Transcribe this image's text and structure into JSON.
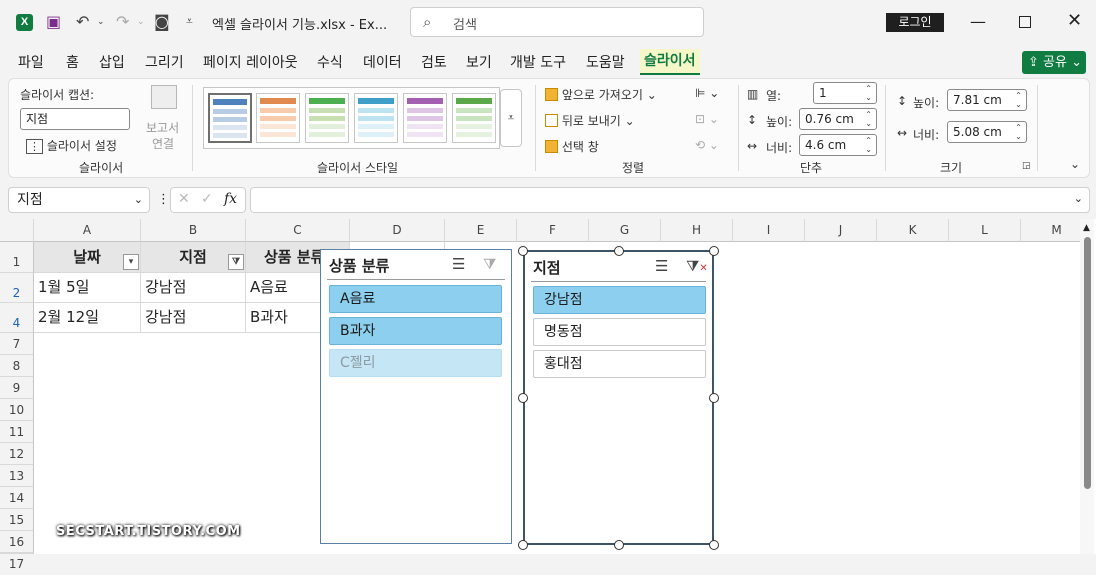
{
  "titlebar": {
    "doc_title": "엑셀 슬라이서 기능.xlsx  -  Ex...",
    "search_placeholder": "검색",
    "login_label": "로그인"
  },
  "tabs": [
    "파일",
    "홈",
    "삽입",
    "그리기",
    "페이지 레이아웃",
    "수식",
    "데이터",
    "검토",
    "보기",
    "개발 도구",
    "도움말",
    "슬라이서"
  ],
  "active_tab": "슬라이서",
  "share_label": "공유",
  "ribbon": {
    "caption_label": "슬라이서 캡션:",
    "caption_value": "지점",
    "settings_label": "슬라이서 설정",
    "report_line1": "보고서",
    "report_line2": "연결",
    "group_slicer": "슬라이서",
    "group_styles": "슬라이서 스타일",
    "bring_forward": "앞으로 가져오기",
    "send_backward": "뒤로 보내기",
    "selection_pane": "선택 창",
    "group_arrange": "정렬",
    "columns_label": "열:",
    "columns_value": "1",
    "btn_height_label": "높이:",
    "btn_height_value": "0.76 cm",
    "btn_width_label": "너비:",
    "btn_width_value": "4.6 cm",
    "group_buttons": "단추",
    "size_height_label": "높이:",
    "size_height_value": "7.81 cm",
    "size_width_label": "너비:",
    "size_width_value": "5.08 cm",
    "group_size": "크기"
  },
  "style_colors": [
    "#4f81bd",
    "#e08a50",
    "#4caf50",
    "#3ea0c8",
    "#a35fb0",
    "#5aa84a"
  ],
  "formula": {
    "namebox": "지점",
    "fx": "fx"
  },
  "columns": [
    "A",
    "B",
    "C",
    "D",
    "E",
    "F",
    "G",
    "H",
    "I",
    "J",
    "K",
    "L",
    "M"
  ],
  "rows": [
    "1",
    "2",
    "4",
    "7",
    "8",
    "9",
    "10",
    "11",
    "12",
    "13",
    "14",
    "15",
    "16",
    "17"
  ],
  "table": {
    "headers": [
      "날짜",
      "지점",
      "상품 분류"
    ],
    "data": [
      [
        "1월 5일",
        "강남점",
        "A음료"
      ],
      [
        "2월 12일",
        "강남점",
        "B과자"
      ]
    ]
  },
  "slicer_category": {
    "title": "상품 분류",
    "items": [
      {
        "label": "A음료",
        "state": "selected"
      },
      {
        "label": "B과자",
        "state": "selected"
      },
      {
        "label": "C젤리",
        "state": "nodata"
      }
    ]
  },
  "slicer_branch": {
    "title": "지점",
    "items": [
      {
        "label": "강남점",
        "state": "selected"
      },
      {
        "label": "명동점",
        "state": "unselected"
      },
      {
        "label": "홍대점",
        "state": "unselected"
      }
    ]
  },
  "watermark": "SECSTART.TISTORY.COM"
}
